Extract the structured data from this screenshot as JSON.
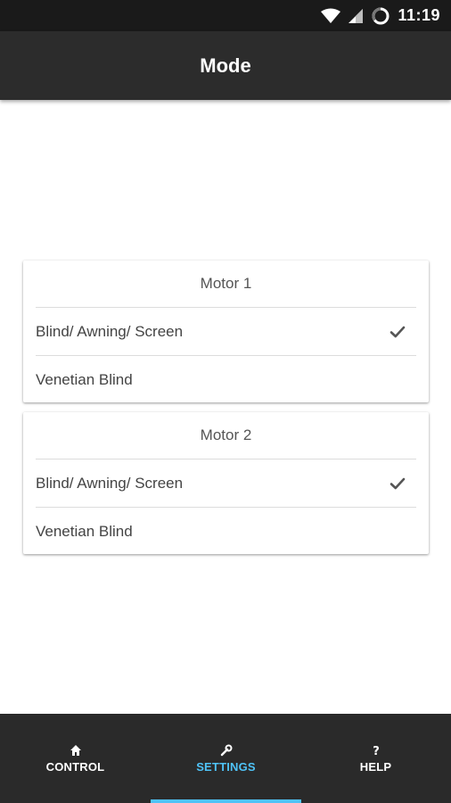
{
  "status_bar": {
    "time": "11:19"
  },
  "app_bar": {
    "title": "Mode"
  },
  "motors": [
    {
      "title": "Motor 1",
      "options": [
        {
          "label": "Blind/ Awning/ Screen",
          "selected": true
        },
        {
          "label": "Venetian Blind",
          "selected": false
        }
      ]
    },
    {
      "title": "Motor 2",
      "options": [
        {
          "label": "Blind/ Awning/ Screen",
          "selected": true
        },
        {
          "label": "Venetian Blind",
          "selected": false
        }
      ]
    }
  ],
  "bottom_nav": {
    "items": [
      {
        "label": "CONTROL",
        "icon": "home-icon",
        "active": false
      },
      {
        "label": "SETTINGS",
        "icon": "wrench-icon",
        "active": true
      },
      {
        "label": "HELP",
        "icon": "question-icon",
        "active": false
      }
    ]
  },
  "colors": {
    "accent": "#4fc3f7",
    "app_bar": "#2c2c2c",
    "status_bar": "#1a1a1a",
    "bottom_nav": "#2a2a2a"
  }
}
